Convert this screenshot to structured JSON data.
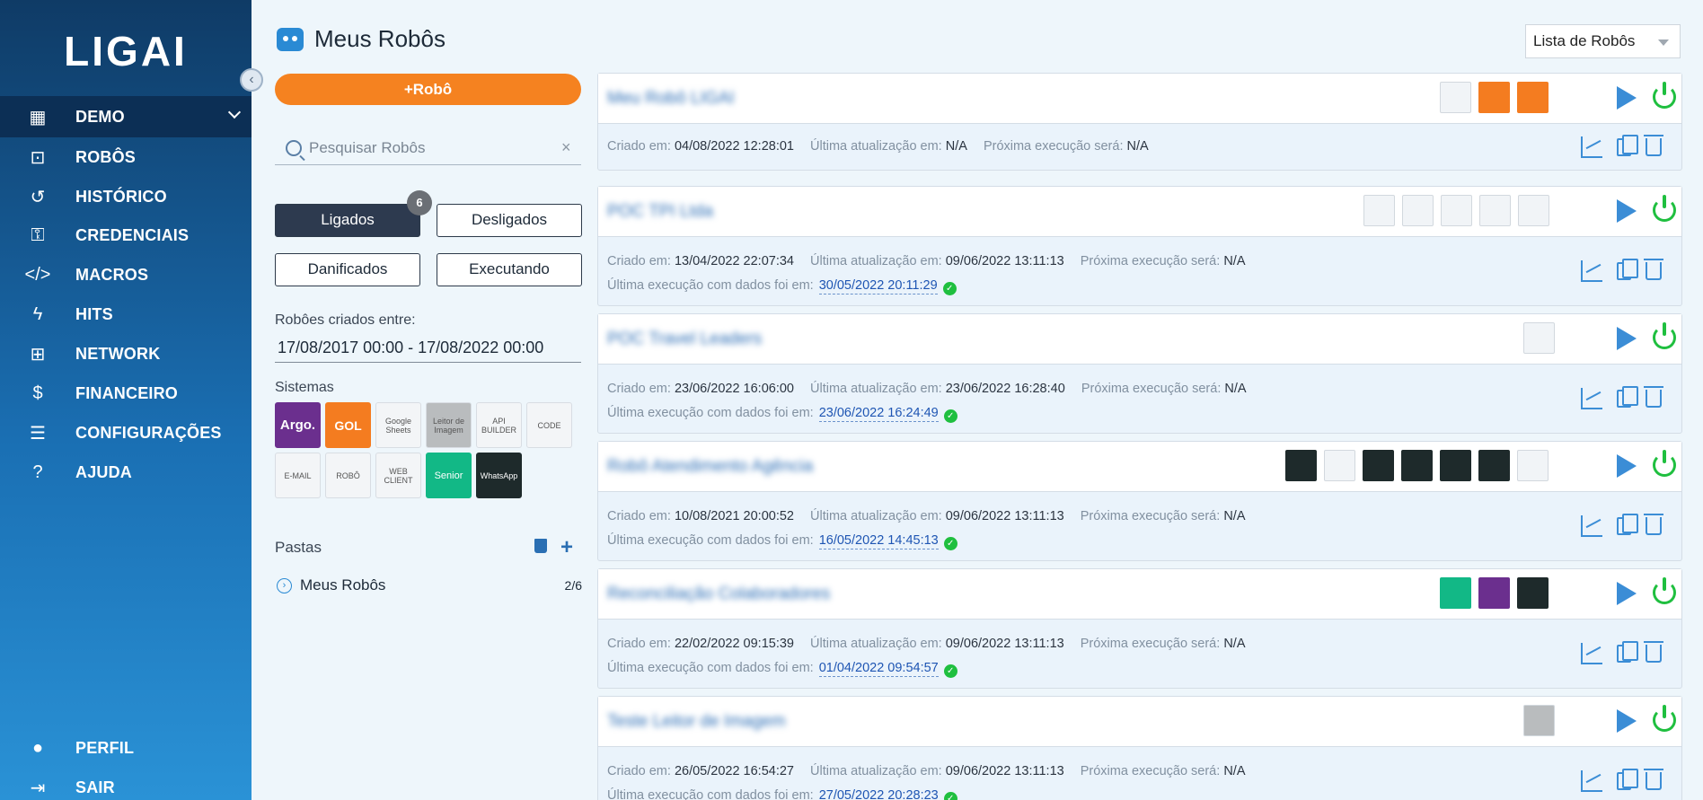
{
  "sidebar": {
    "logo": "LIGAI",
    "org": "DEMO",
    "items": [
      {
        "label": "ROBÔS",
        "icon": "robot-icon"
      },
      {
        "label": "HISTÓRICO",
        "icon": "history-icon"
      },
      {
        "label": "CREDENCIAIS",
        "icon": "key-icon"
      },
      {
        "label": "MACROS",
        "icon": "code-icon"
      },
      {
        "label": "HITS",
        "icon": "bolt-icon"
      },
      {
        "label": "NETWORK",
        "icon": "network-icon"
      },
      {
        "label": "FINANCEIRO",
        "icon": "invoice-icon"
      },
      {
        "label": "CONFIGURAÇÕES",
        "icon": "sliders-icon"
      },
      {
        "label": "AJUDA",
        "icon": "help-icon"
      }
    ],
    "bottom": [
      {
        "label": "PERFIL",
        "icon": "user-icon"
      },
      {
        "label": "SAIR",
        "icon": "logout-icon"
      }
    ]
  },
  "panel": {
    "title": "Meus Robôs",
    "add_button": "+Robô",
    "search_placeholder": "Pesquisar Robôs",
    "filters": {
      "ligados": "Ligados",
      "ligados_count": "6",
      "desligados": "Desligados",
      "danificados": "Danificados",
      "executando": "Executando"
    },
    "date_label": "Robôes criados entre:",
    "date_range": "17/08/2017 00:00 - 17/08/2022 00:00",
    "systems_label": "Sistemas",
    "systems": [
      "Argo.",
      "GOL",
      "Google Sheets",
      "Leitor de Imagem",
      "API BUILDER",
      "CODE",
      "E-MAIL",
      "ROBÔ",
      "WEB CLIENT",
      "Senior",
      "WhatsApp"
    ],
    "folders_label": "Pastas",
    "folder": {
      "name": "Meus Robôs",
      "count": "2/6"
    }
  },
  "list_select": "Lista de Robôs",
  "labels": {
    "created": "Criado em:",
    "updated": "Última atualização em:",
    "next": "Próxima execução será:",
    "last_exec": "Última execução com dados foi em:"
  },
  "colors": {
    "accent": "#f58220",
    "primary": "#2a8ad4",
    "success": "#1fbf3f"
  },
  "robots": [
    {
      "name": "Meu Robô LIGAI",
      "created": "04/08/2022 12:28:01",
      "updated": "N/A",
      "next": "N/A",
      "last_exec": ""
    },
    {
      "name": "POC TPI Ltda",
      "created": "13/04/2022 22:07:34",
      "updated": "09/06/2022 13:11:13",
      "next": "N/A",
      "last_exec": "30/05/2022 20:11:29"
    },
    {
      "name": "POC Travel Leaders",
      "created": "23/06/2022 16:06:00",
      "updated": "23/06/2022 16:28:40",
      "next": "N/A",
      "last_exec": "23/06/2022 16:24:49"
    },
    {
      "name": "Robô Atendimento Agência",
      "created": "10/08/2021 20:00:52",
      "updated": "09/06/2022 13:11:13",
      "next": "N/A",
      "last_exec": "16/05/2022 14:45:13"
    },
    {
      "name": "Reconciliação Colaboradores",
      "created": "22/02/2022 09:15:39",
      "updated": "09/06/2022 13:11:13",
      "next": "N/A",
      "last_exec": "01/04/2022 09:54:57"
    },
    {
      "name": "Teste Leitor de Imagem",
      "created": "26/05/2022 16:54:27",
      "updated": "09/06/2022 13:11:13",
      "next": "N/A",
      "last_exec": "27/05/2022 20:28:23"
    }
  ]
}
